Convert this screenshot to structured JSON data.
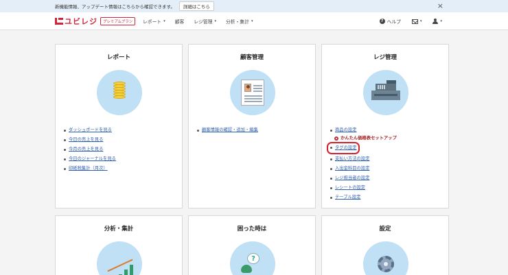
{
  "notice": {
    "text": "新機能情報、アップデート情報はこちらから確認できます。",
    "button": "詳細はこちら",
    "close": "×"
  },
  "header": {
    "logo_text": "ユビレジ",
    "plan_badge": "プレミアムプラン",
    "nav": [
      {
        "label": "レポート",
        "dropdown": true
      },
      {
        "label": "顧客",
        "dropdown": false
      },
      {
        "label": "レジ管理",
        "dropdown": true
      },
      {
        "label": "分析・集計",
        "dropdown": true
      }
    ],
    "help": "ヘルプ",
    "caret": "▾"
  },
  "cards": {
    "report": {
      "title": "レポート",
      "icon": "coins-icon",
      "links": [
        "ダッシュボードを見る",
        "今日の売上を見る",
        "今月の売上を見る",
        "今日のジャーナルを見る",
        "印紙税集計（月次）"
      ]
    },
    "customer": {
      "title": "顧客管理",
      "icon": "profile-document-icon",
      "links": [
        "顧客情報の確認・追加・編集"
      ]
    },
    "register": {
      "title": "レジ管理",
      "icon": "cash-register-icon",
      "links": [
        "商品の設定",
        "かんたん価格表セットアップ",
        "タグの設定",
        "支払い方法の設定",
        "入出金科目の設定",
        "レジ担当者の設定",
        "レシートの設定",
        "テーブル設定"
      ]
    },
    "analysis": {
      "title": "分析・集計",
      "icon": "bar-chart-icon"
    },
    "trouble": {
      "title": "困った時は",
      "icon": "question-bubble-icon",
      "bubble": "?"
    },
    "settings": {
      "title": "設定",
      "icon": "gear-icon"
    }
  },
  "colors": {
    "brand": "#d3233a",
    "link": "#2a5db0",
    "circle_bg": "#bfe0f5",
    "highlight": "#d81e2b"
  }
}
